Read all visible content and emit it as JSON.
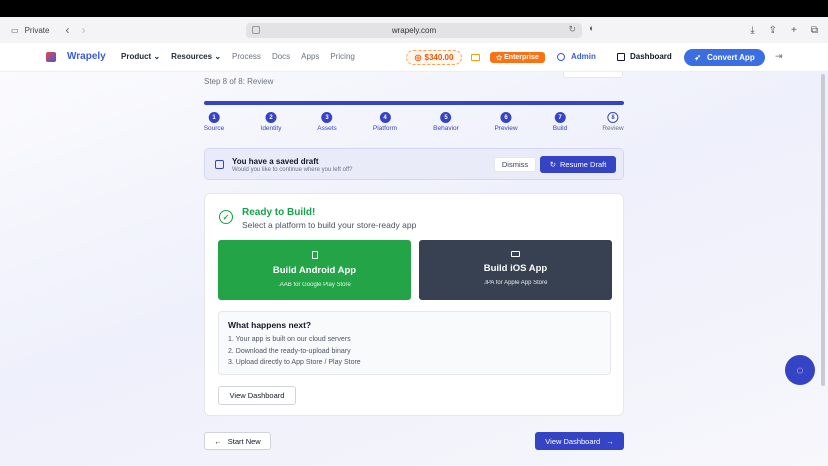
{
  "browser": {
    "mode_label": "Private",
    "url": "wrapely.com"
  },
  "nav": {
    "brand": "Wrapely",
    "links": [
      "Product",
      "Resources",
      "Process",
      "Docs",
      "Apps",
      "Pricing"
    ],
    "balance": "$340.00",
    "plan_badge": "Enterprise",
    "admin_label": "Admin",
    "dashboard_label": "Dashboard",
    "convert_label": "Convert App"
  },
  "wizard": {
    "step_label": "Step 8 of 8: Review",
    "progress": 1.0,
    "steps": [
      {
        "num": "1",
        "label": "Source"
      },
      {
        "num": "2",
        "label": "Identity"
      },
      {
        "num": "3",
        "label": "Assets"
      },
      {
        "num": "4",
        "label": "Platform"
      },
      {
        "num": "5",
        "label": "Behavior"
      },
      {
        "num": "6",
        "label": "Preview"
      },
      {
        "num": "7",
        "label": "Build"
      },
      {
        "num": "8",
        "label": "Review"
      }
    ]
  },
  "draft": {
    "title": "You have a saved draft",
    "subtitle": "Would you like to continue where you left off?",
    "dismiss_label": "Dismiss",
    "resume_label": "Resume Draft"
  },
  "ready": {
    "title": "Ready to Build!",
    "subtitle": "Select a platform to build your store-ready app",
    "android": {
      "title": "Build Android App",
      "sub": ".AAB for Google Play Store"
    },
    "ios": {
      "title": "Build iOS App",
      "sub": ".IPA for Apple App Store"
    },
    "next_title": "What happens next?",
    "next_steps": [
      "1. Your app is built on our cloud servers",
      "2. Download the ready-to-upload binary",
      "3. Upload directly to App Store / Play Store"
    ],
    "view_dashboard_label": "View Dashboard"
  },
  "footer": {
    "start_new_label": "Start New",
    "view_dashboard_label": "View Dashboard"
  },
  "colors": {
    "primary": "#3544c4",
    "success": "#16a34a",
    "android": "#22a447",
    "ios": "#374151"
  }
}
